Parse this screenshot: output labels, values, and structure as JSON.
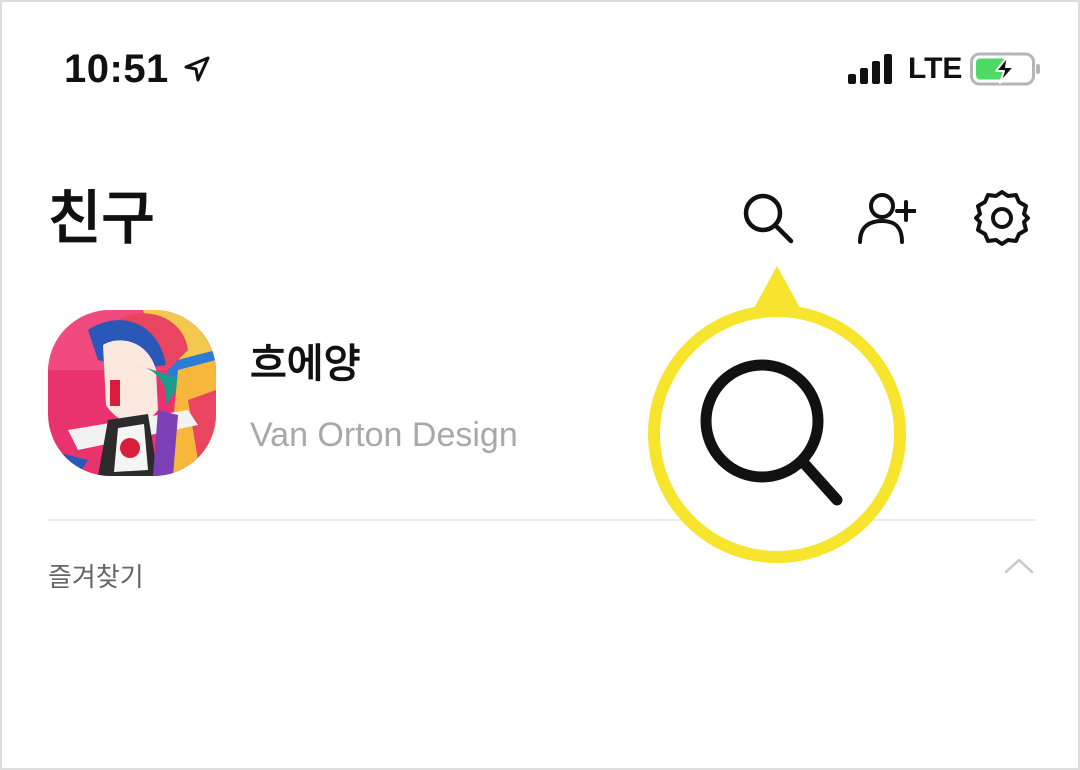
{
  "status_bar": {
    "time": "10:51",
    "network": "LTE",
    "location_icon": "location-arrow-icon",
    "signal_icon": "signal-bars-icon",
    "battery_icon": "battery-charging-icon",
    "battery_color": "#4cd964"
  },
  "header": {
    "title": "친구",
    "icons": [
      "search-icon",
      "add-friend-icon",
      "settings-icon"
    ]
  },
  "profile": {
    "name": "흐에양",
    "status_message": "Van Orton Design"
  },
  "favorites": {
    "label": "즐겨찾기",
    "toggle_icon": "chevron-up-icon"
  },
  "callout": {
    "icon": "search-icon",
    "highlight_color": "#f7e42d"
  }
}
